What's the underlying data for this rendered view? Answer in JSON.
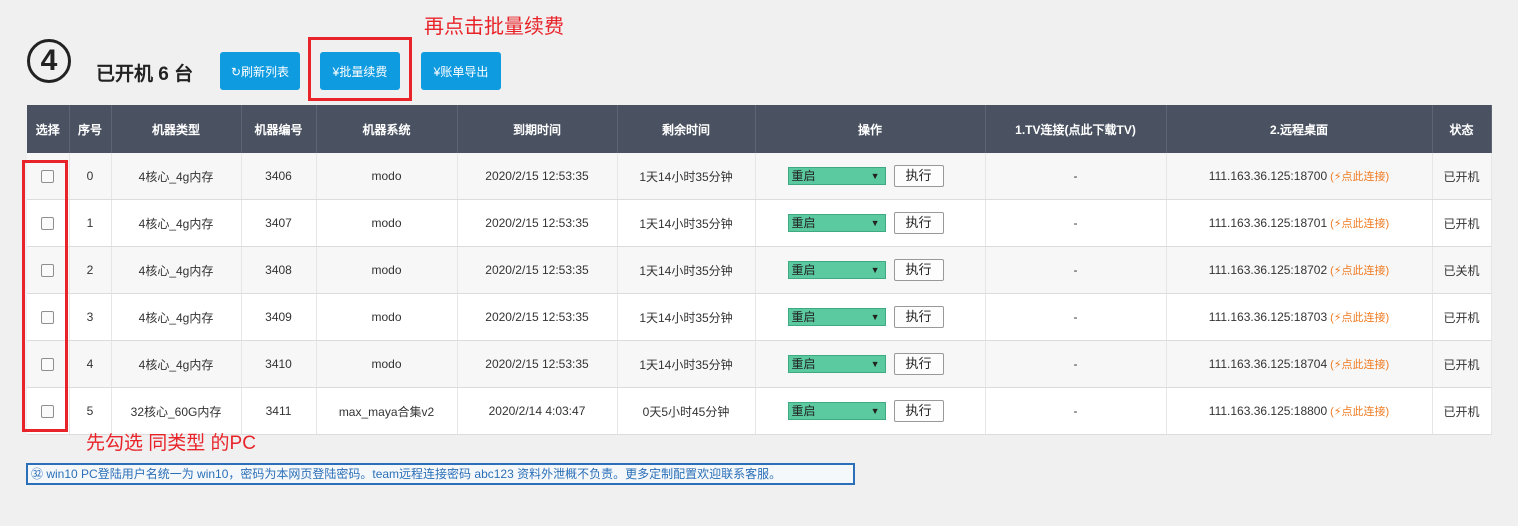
{
  "annotations": {
    "top": "再点击批量续费",
    "bottom": "先勾选 同类型 的PC"
  },
  "step_number": "4",
  "heading": "已开机 6 台",
  "toolbar": {
    "refresh_label": "↻刷新列表",
    "renew_label": "¥批量续费",
    "export_label": "¥账单导出"
  },
  "table": {
    "headers": [
      "选择",
      "序号",
      "机器类型",
      "机器编号",
      "机器系统",
      "到期时间",
      "剩余时间",
      "操作",
      "1.TV连接(点此下载TV)",
      "2.远程桌面",
      "状态"
    ],
    "rows": [
      {
        "idx": "0",
        "type": "4核心_4g内存",
        "id": "3406",
        "os": "modo",
        "expire": "2020/2/15 12:53:35",
        "remain": "1天14小时35分钟",
        "op": "重启",
        "exec": "执行",
        "tv": "-",
        "rdp": "111.163.36.125:18700",
        "rdp_link": "(⚡点此连接)",
        "status": "已开机"
      },
      {
        "idx": "1",
        "type": "4核心_4g内存",
        "id": "3407",
        "os": "modo",
        "expire": "2020/2/15 12:53:35",
        "remain": "1天14小时35分钟",
        "op": "重启",
        "exec": "执行",
        "tv": "-",
        "rdp": "111.163.36.125:18701",
        "rdp_link": "(⚡点此连接)",
        "status": "已开机"
      },
      {
        "idx": "2",
        "type": "4核心_4g内存",
        "id": "3408",
        "os": "modo",
        "expire": "2020/2/15 12:53:35",
        "remain": "1天14小时35分钟",
        "op": "重启",
        "exec": "执行",
        "tv": "-",
        "rdp": "111.163.36.125:18702",
        "rdp_link": "(⚡点此连接)",
        "status": "已关机"
      },
      {
        "idx": "3",
        "type": "4核心_4g内存",
        "id": "3409",
        "os": "modo",
        "expire": "2020/2/15 12:53:35",
        "remain": "1天14小时35分钟",
        "op": "重启",
        "exec": "执行",
        "tv": "-",
        "rdp": "111.163.36.125:18703",
        "rdp_link": "(⚡点此连接)",
        "status": "已开机"
      },
      {
        "idx": "4",
        "type": "4核心_4g内存",
        "id": "3410",
        "os": "modo",
        "expire": "2020/2/15 12:53:35",
        "remain": "1天14小时35分钟",
        "op": "重启",
        "exec": "执行",
        "tv": "-",
        "rdp": "111.163.36.125:18704",
        "rdp_link": "(⚡点此连接)",
        "status": "已开机"
      },
      {
        "idx": "5",
        "type": "32核心_60G内存",
        "id": "3411",
        "os": "max_maya合集v2",
        "expire": "2020/2/14 4:03:47",
        "remain": "0天5小时45分钟",
        "op": "重启",
        "exec": "执行",
        "tv": "-",
        "rdp": "111.163.36.125:18800",
        "rdp_link": "(⚡点此连接)",
        "status": "已开机"
      }
    ]
  },
  "notice": "㉜ win10 PC登陆用户名统一为 win10，密码为本网页登陆密码。team远程连接密码 abc123 资料外泄概不负责。更多定制配置欢迎联系客服。",
  "colors": {
    "accent_button": "#0f9be0",
    "table_header": "#4a5262",
    "select_bg": "#5ccaa1",
    "annotation_red": "#e8242a",
    "link_orange": "#ef7b22",
    "notice_blue": "#2a6fb8"
  }
}
